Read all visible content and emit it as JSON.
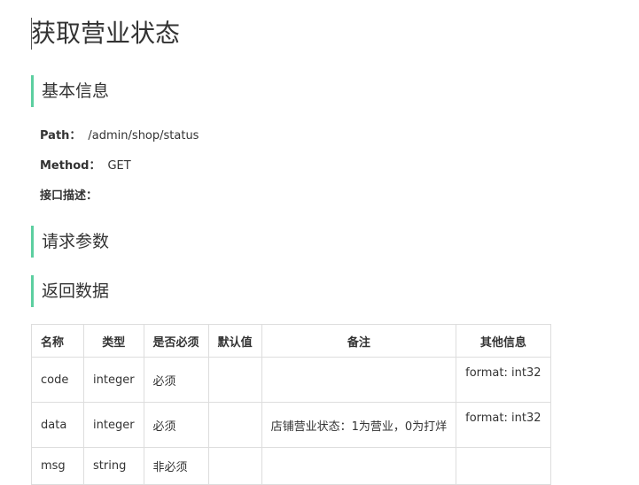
{
  "page_title": "获取营业状态",
  "sections": {
    "basic": "基本信息",
    "request": "请求参数",
    "response": "返回数据"
  },
  "basic_info": {
    "path_label": "Path：",
    "path_value": "/admin/shop/status",
    "method_label": "Method：",
    "method_value": "GET",
    "desc_label": "接口描述："
  },
  "response_table": {
    "headers": [
      "名称",
      "类型",
      "是否必须",
      "默认值",
      "备注",
      "其他信息"
    ],
    "rows": [
      {
        "name": "code",
        "type": "integer",
        "required": "必须",
        "default": "",
        "note": "",
        "other": "format: int32"
      },
      {
        "name": "data",
        "type": "integer",
        "required": "必须",
        "default": "",
        "note": "店铺营业状态：1为营业，0为打烊",
        "other": "format: int32"
      },
      {
        "name": "msg",
        "type": "string",
        "required": "非必须",
        "default": "",
        "note": "",
        "other": ""
      }
    ]
  }
}
